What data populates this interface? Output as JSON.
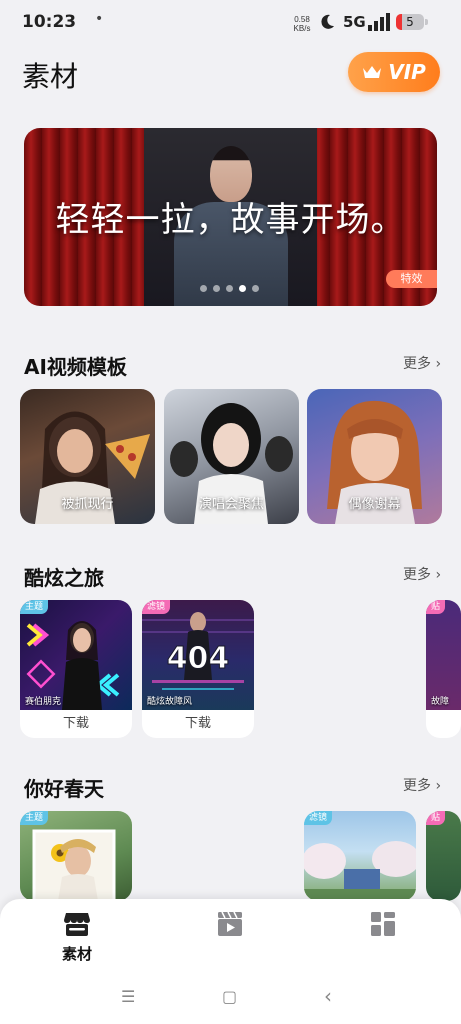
{
  "status_bar": {
    "time": "10:23",
    "dot": "•",
    "net_speed_value": "0.58",
    "net_speed_unit": "KB/s",
    "network": "5G",
    "battery": "5"
  },
  "header": {
    "title": "素材",
    "vip_label": "VIP"
  },
  "banner": {
    "title": "轻轻一拉，故事开场。",
    "tag": "特效",
    "dot_count": 5,
    "active_dot": 3
  },
  "sections": {
    "ai_templates": {
      "title": "AI视频模板",
      "more": "更多",
      "items": [
        {
          "label": "被抓现行"
        },
        {
          "label": "演唱会聚焦"
        },
        {
          "label": "偶像谢幕"
        }
      ]
    },
    "cool_journey": {
      "title": "酷炫之旅",
      "more": "更多",
      "items": [
        {
          "tag": "主题",
          "name": "赛伯朋克",
          "download": "下载"
        },
        {
          "tag": "滤镜",
          "name": "酷炫故障风",
          "download": "下载",
          "overlay": "404"
        },
        {
          "tag": "贴",
          "name": "故障"
        }
      ]
    },
    "hello_spring": {
      "title": "你好春天",
      "more": "更多",
      "items": [
        {
          "tag": "主题"
        },
        {
          "tag": "滤镜"
        },
        {
          "tag": "贴"
        }
      ]
    }
  },
  "bottom_nav": {
    "items": [
      {
        "label": "素材",
        "icon": "store-icon"
      },
      {
        "label": "",
        "icon": "video-clapper-icon"
      },
      {
        "label": "",
        "icon": "grid-apps-icon"
      }
    ]
  },
  "system_nav": {
    "menu": "☰",
    "home": "▢",
    "back": "‹"
  },
  "colors": {
    "accent_orange": "#ff7d1c",
    "tag_blue": "#5ec3e6",
    "tag_pink": "#f46bb5",
    "banner_tag": "#ff7b5a"
  }
}
